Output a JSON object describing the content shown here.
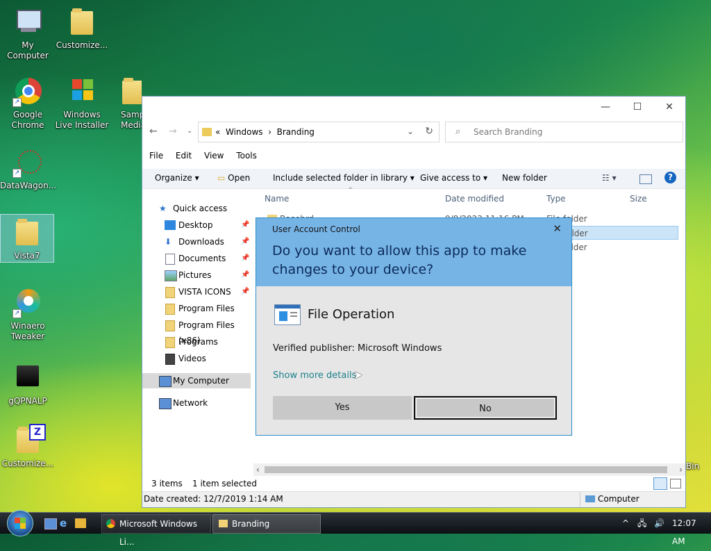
{
  "desktop": {
    "icons": [
      {
        "label": "My Computer"
      },
      {
        "label": "Customize..."
      },
      {
        "label": "Google Chrome"
      },
      {
        "label": "Windows Live Installer"
      },
      {
        "label": "Sample Media"
      },
      {
        "label": "DataWagon..."
      },
      {
        "label": "Vista7"
      },
      {
        "label": "Winaero Tweaker"
      },
      {
        "label": "gQPNALP"
      },
      {
        "label": "Customize..."
      },
      {
        "label": "Bin"
      }
    ]
  },
  "explorer": {
    "path": [
      "Windows",
      "Branding"
    ],
    "search_placeholder": "Search Branding",
    "menu": [
      "File",
      "Edit",
      "View",
      "Tools"
    ],
    "commands": {
      "organize": "Organize",
      "open": "Open",
      "include": "Include selected folder in library",
      "give_access": "Give access to",
      "new_folder": "New folder"
    },
    "columns": {
      "name": "Name",
      "date": "Date modified",
      "type": "Type",
      "size": "Size"
    },
    "files": [
      {
        "name": "Basebrd",
        "date": "9/8/2023 11:16 PM",
        "type": "File folder"
      },
      {
        "name": "",
        "date": "",
        "type": "File folder"
      },
      {
        "name": "",
        "date": "",
        "type": "File folder"
      }
    ],
    "nav": {
      "quick_access": "Quick access",
      "items": [
        "Desktop",
        "Downloads",
        "Documents",
        "Pictures",
        "VISTA ICONS",
        "Program Files",
        "Program Files (x86)",
        "Programs",
        "Videos"
      ],
      "my_computer": "My Computer",
      "network": "Network"
    },
    "status": {
      "items": "3 items",
      "selected": "1 item selected"
    },
    "details": {
      "date_created": "Date created: 12/7/2019 1:14 AM",
      "location": "Computer"
    }
  },
  "uac": {
    "caption": "User Account Control",
    "question": "Do you want to allow this app to make changes to your device?",
    "app_name": "File Operation",
    "publisher": "Verified publisher: Microsoft Windows",
    "more": "Show more details",
    "yes": "Yes",
    "no": "No"
  },
  "taskbar": {
    "windows": [
      {
        "label": "Microsoft Windows Li..."
      },
      {
        "label": "Branding"
      }
    ],
    "clock": "12:07 AM"
  },
  "colors": {
    "uac_header": "#77b4e6",
    "uac_border": "#2c8ecb",
    "selection": "#cce4f7"
  }
}
